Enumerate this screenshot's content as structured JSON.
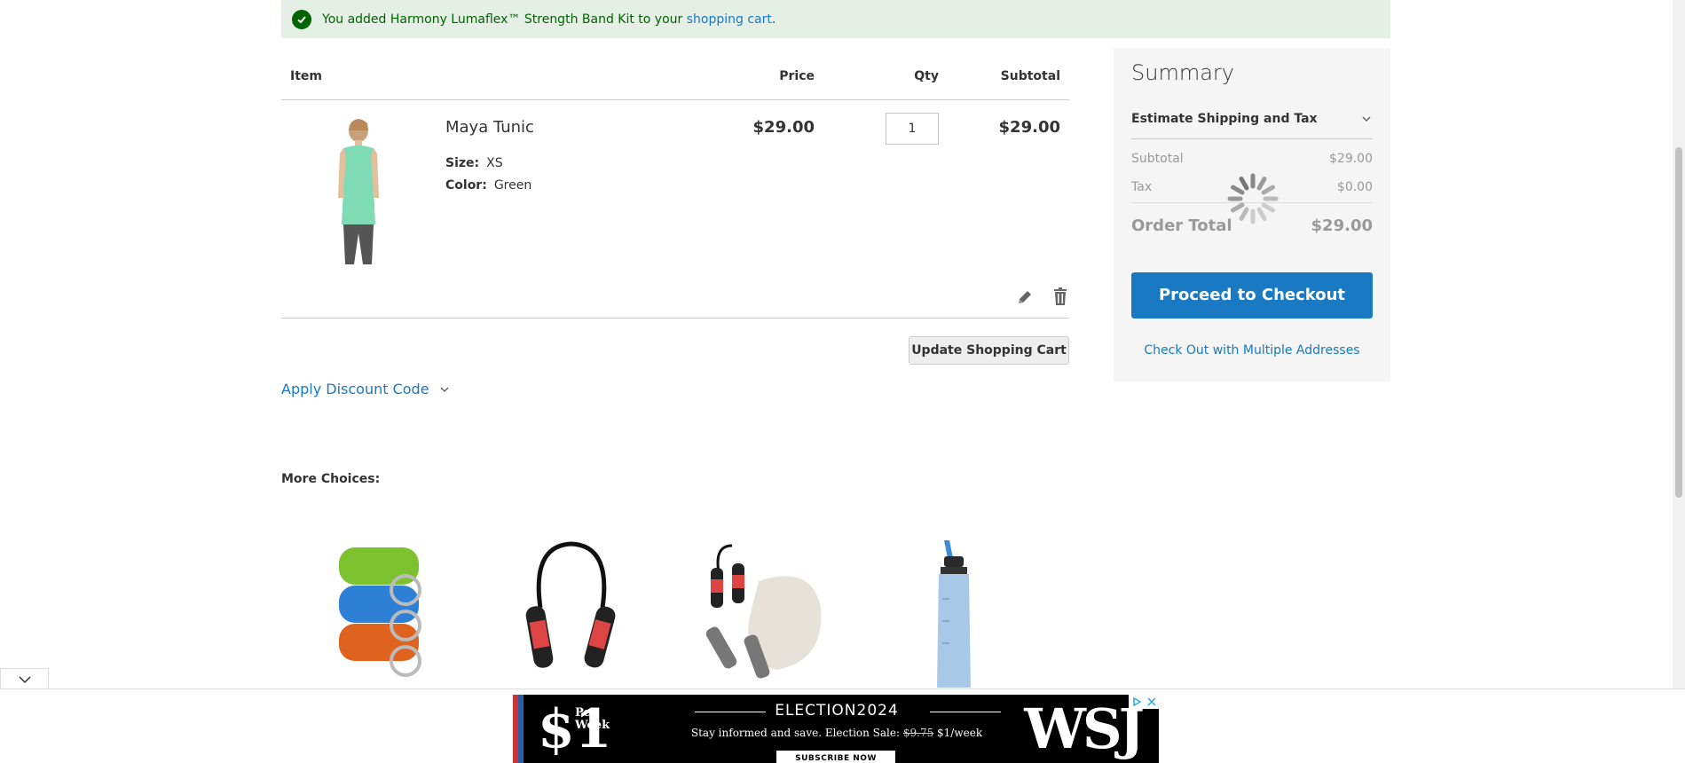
{
  "message": {
    "text_before": "You added Harmony Lumaflex™ Strength Band Kit to your ",
    "link": "shopping cart",
    "text_after": "."
  },
  "cart": {
    "headers": {
      "item": "Item",
      "price": "Price",
      "qty": "Qty",
      "subtotal": "Subtotal"
    },
    "items": [
      {
        "name": "Maya Tunic",
        "options": [
          {
            "label": "Size:",
            "value": "XS"
          },
          {
            "label": "Color:",
            "value": "Green"
          }
        ],
        "price": "$29.00",
        "qty": "1",
        "subtotal": "$29.00"
      }
    ],
    "update_label": "Update Shopping Cart",
    "discount_label": "Apply Discount Code"
  },
  "summary": {
    "title": "Summary",
    "estimate_label": "Estimate Shipping and Tax",
    "subtotal_label": "Subtotal",
    "subtotal_value": "$29.00",
    "tax_label": "Tax",
    "tax_value": "$0.00",
    "total_label": "Order Total",
    "total_value": "$29.00",
    "checkout_label": "Proceed to Checkout",
    "multi_label": "Check Out with Multiple Addresses"
  },
  "more_choices": {
    "title": "More Choices:"
  },
  "ad": {
    "dollar": "$1",
    "per_week_1": "Per",
    "per_week_2": "Week",
    "election": "ELECTION2024",
    "tagline_1": "Stay informed and save. Election Sale: ",
    "tagline_old_price": "$9.75",
    "tagline_2": " $1/week",
    "subscribe": "SUBSCRIBE NOW",
    "brand": "WSJ"
  },
  "colors": {
    "link": "#1979c3",
    "success_bg": "#e5efe5",
    "success_text": "#006400",
    "checkout_bg": "#1979c3"
  }
}
